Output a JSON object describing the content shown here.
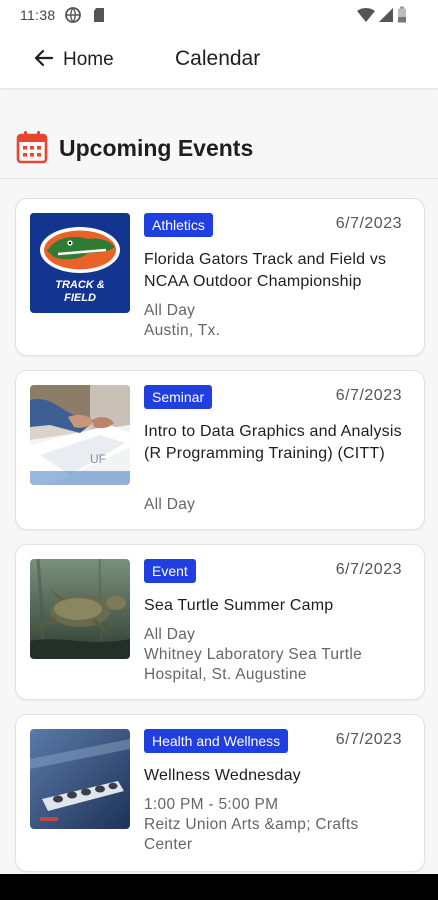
{
  "status_bar": {
    "time": "11:38",
    "icons": [
      "vpn-globe-icon",
      "sd-card-icon",
      "wifi-icon",
      "signal-icon",
      "battery-icon"
    ]
  },
  "app_bar": {
    "back_label": "Home",
    "title": "Calendar"
  },
  "section": {
    "title": "Upcoming Events",
    "icon": "calendar-icon",
    "icon_color": "#e8452c"
  },
  "colors": {
    "badge_bg": "#1f3fe0",
    "accent": "#e8452c"
  },
  "events": [
    {
      "category": "Athletics",
      "date": "6/7/2023",
      "title": "Florida Gators Track and Field vs NCAA Outdoor Championship",
      "when": "All Day",
      "where": "Austin, Tx.",
      "image": "gators-track-field-logo",
      "image_text": [
        "TRACK &",
        "FIELD"
      ]
    },
    {
      "category": "Seminar",
      "date": "6/7/2023",
      "title": "Intro to Data Graphics and Analysis (R Programming Training) (CITT)",
      "when": "All Day",
      "where": "",
      "image": "laptop-typing-photo"
    },
    {
      "category": "Event",
      "date": "6/7/2023",
      "title": "Sea Turtle Summer Camp",
      "when": "All Day",
      "where": "Whitney Laboratory Sea Turtle Hospital, St. Augustine",
      "image": "sea-turtle-photo"
    },
    {
      "category": "Health and Wellness",
      "date": "6/7/2023",
      "title": "Wellness Wednesday",
      "when": "1:00 PM - 5:00 PM",
      "where": "Reitz Union Arts &amp; Crafts Center",
      "image": "wellness-palette-photo"
    }
  ]
}
